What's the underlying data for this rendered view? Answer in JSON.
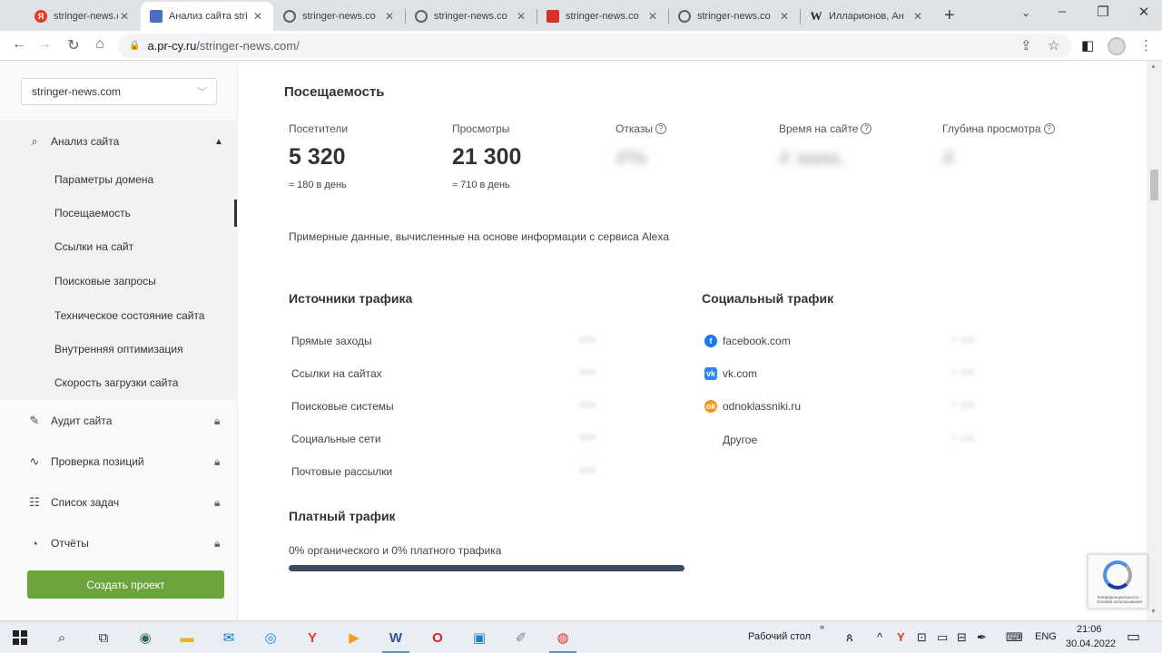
{
  "browser": {
    "tabs": [
      {
        "title": "stringer-news.co",
        "icon": "yandex-icon",
        "color": "#e63a1e"
      },
      {
        "title": "Анализ сайта stri",
        "icon": "prcy-icon",
        "color": "#4a6fc6",
        "active": true
      },
      {
        "title": "stringer-news.co",
        "icon": "globe-icon",
        "color": "#5f6368"
      },
      {
        "title": "stringer-news.co",
        "icon": "globe-icon",
        "color": "#5f6368"
      },
      {
        "title": "stringer-news.co",
        "icon": "stringer-icon",
        "color": "#d93025"
      },
      {
        "title": "stringer-news.co",
        "icon": "globe-icon",
        "color": "#5f6368"
      },
      {
        "title": "Илларионов, Ан",
        "icon": "wikipedia-icon",
        "color": "#222222"
      }
    ],
    "url_domain": "a.pr-cy.ru",
    "url_path": "/stringer-news.com/"
  },
  "sidebar": {
    "site_select": "stringer-news.com",
    "analysis_label": "Анализ сайта",
    "sub_items": [
      "Параметры домена",
      "Посещаемость",
      "Ссылки на сайт",
      "Поисковые запросы",
      "Техническое состояние сайта",
      "Внутренняя оптимизация",
      "Скорость загрузки сайта"
    ],
    "locked_items": [
      "Аудит сайта",
      "Проверка позиций",
      "Список задач",
      "Отчёты"
    ],
    "create_button": "Создать проект"
  },
  "main": {
    "title": "Посещаемость",
    "metrics": [
      {
        "label": "Посетители",
        "value": "5 320",
        "note": "≈ 180 в день"
      },
      {
        "label": "Просмотры",
        "value": "21 300",
        "note": "≈ 710 в день"
      },
      {
        "label": "Отказы",
        "value": "#%"
      },
      {
        "label": "Время на сайте",
        "value": "# мин."
      },
      {
        "label": "Глубина просмотра",
        "value": "#"
      }
    ],
    "data_note": "Примерные данные, вычисленные на основе информации с сервиса Alexa",
    "traffic_sources": {
      "title": "Источники трафика",
      "rows": [
        {
          "label": "Прямые заходы",
          "value": "###"
        },
        {
          "label": "Ссылки на сайтах",
          "value": "###"
        },
        {
          "label": "Поисковые системы",
          "value": "###"
        },
        {
          "label": "Социальные сети",
          "value": "###"
        },
        {
          "label": "Почтовые рассылки",
          "value": "###"
        }
      ]
    },
    "social_traffic": {
      "title": "Социальный трафик",
      "rows": [
        {
          "label": "facebook.com",
          "value": "< 1%",
          "icon": "facebook-icon"
        },
        {
          "label": "vk.com",
          "value": "< 1%",
          "icon": "vk-icon"
        },
        {
          "label": "odnoklassniki.ru",
          "value": "< 1%",
          "icon": "odnoklassniki-icon"
        },
        {
          "label": "Другое",
          "value": "< 1%"
        }
      ]
    },
    "paid_traffic": {
      "title": "Платный трафик",
      "note": "0% органического и 0% платного трафика",
      "paid_fraction": 0
    }
  },
  "recaptcha": {
    "text": "Конфиденциальность - Условия использования"
  },
  "taskbar": {
    "desktop_label": "Рабочий стол",
    "lang": "ENG",
    "time": "21:06",
    "date": "30.04.2022"
  },
  "colors": {
    "accent_green": "#6ba43a",
    "progress_dark": "#3d4a63",
    "sidebar_bg": "#fafafa"
  }
}
